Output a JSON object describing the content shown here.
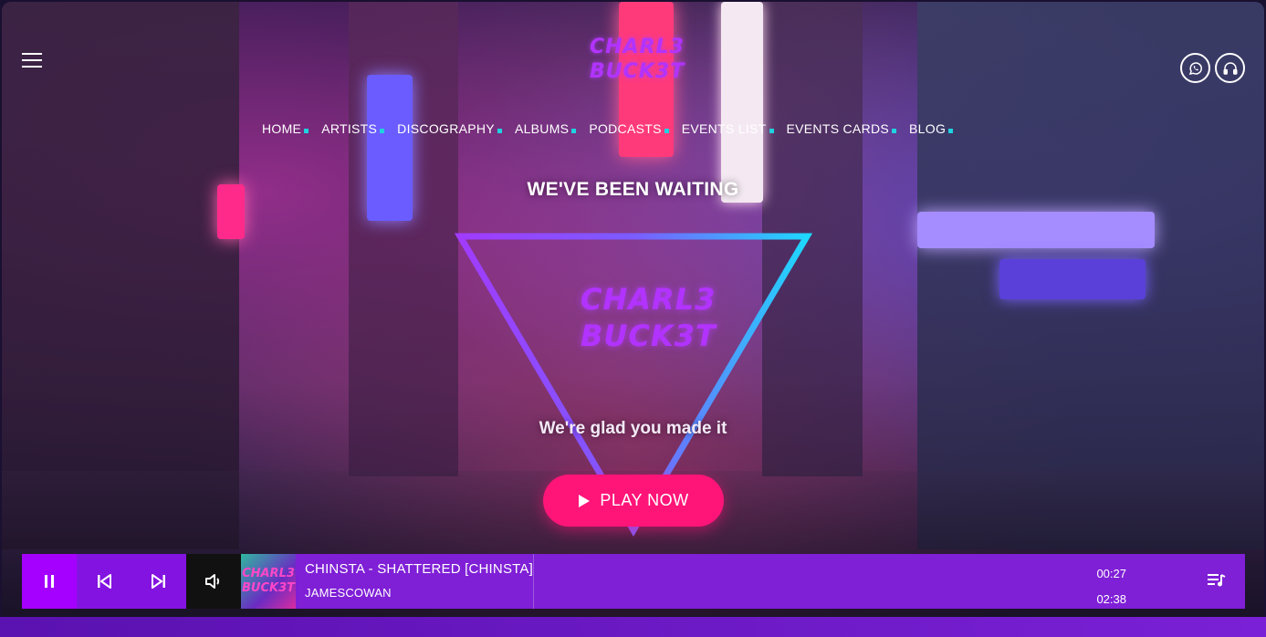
{
  "header": {
    "logo_text_line1": "CHARL3",
    "logo_text_line2": "BUCK3T",
    "menu_icon": "hamburger-icon",
    "social_icons": [
      "whatsapp-icon",
      "headphones-icon"
    ]
  },
  "nav": {
    "items": [
      {
        "label": "HOME"
      },
      {
        "label": "ARTISTS"
      },
      {
        "label": "DISCOGRAPHY"
      },
      {
        "label": "ALBUMS"
      },
      {
        "label": "PODCASTS"
      },
      {
        "label": "EVENTS LIST"
      },
      {
        "label": "EVENTS CARDS"
      },
      {
        "label": "BLOG"
      }
    ],
    "accent_color": "#1fd2e0"
  },
  "hero": {
    "headline": "WE'VE BEEN WAITING",
    "logo_line1": "CHARL3",
    "logo_line2": "BUCK3T",
    "tagline": "We're glad you made it",
    "cta_label": "PLAY NOW",
    "cta_color": "#ff1478"
  },
  "player": {
    "track_title": "CHINSTA - SHATTERED [CHINSTA]",
    "artist": "JAMESCOWAN",
    "current_time": "00:27",
    "duration": "02:38",
    "cover_line1": "CHARL3",
    "cover_line2": "BUCK3T",
    "bar_color": "#7f1fd6",
    "icons": [
      "pause-icon",
      "skip-back-icon",
      "skip-forward-icon",
      "volume-icon",
      "playlist-icon"
    ]
  }
}
